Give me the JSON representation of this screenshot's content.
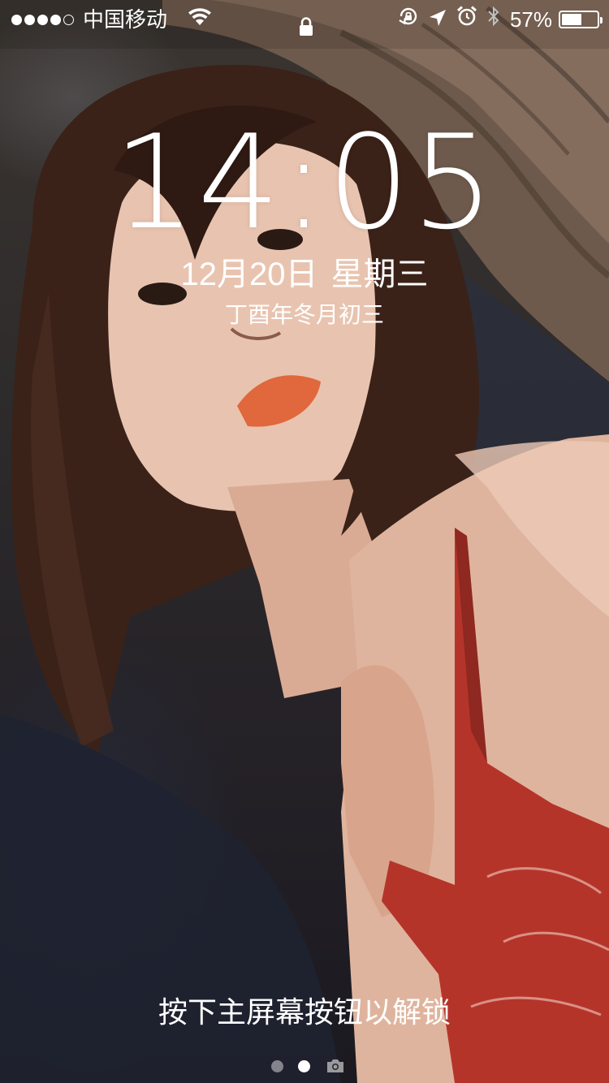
{
  "status_bar": {
    "signal_bars_filled": 4,
    "signal_bars_total": 5,
    "carrier": "中国移动",
    "battery_percent_label": "57%",
    "battery_level": 0.57,
    "icons": [
      "wifi-icon",
      "lock-icon",
      "rotation-lock-icon",
      "location-arrow-icon",
      "alarm-clock-icon",
      "bluetooth-icon",
      "battery-icon"
    ]
  },
  "lockscreen": {
    "time": "14:05",
    "date": "12月20日",
    "weekday": "星期三",
    "lunar_date": "丁酉年冬月初三",
    "unlock_hint": "按下主屏幕按钮以解锁",
    "pages": {
      "count": 2,
      "active_index": 1,
      "trailing_icon": "camera-icon"
    }
  },
  "colors": {
    "text": "#ffffff",
    "inactive_dot": "#ffffff73",
    "lips": "#e0683c",
    "dress": "#b5342a"
  }
}
